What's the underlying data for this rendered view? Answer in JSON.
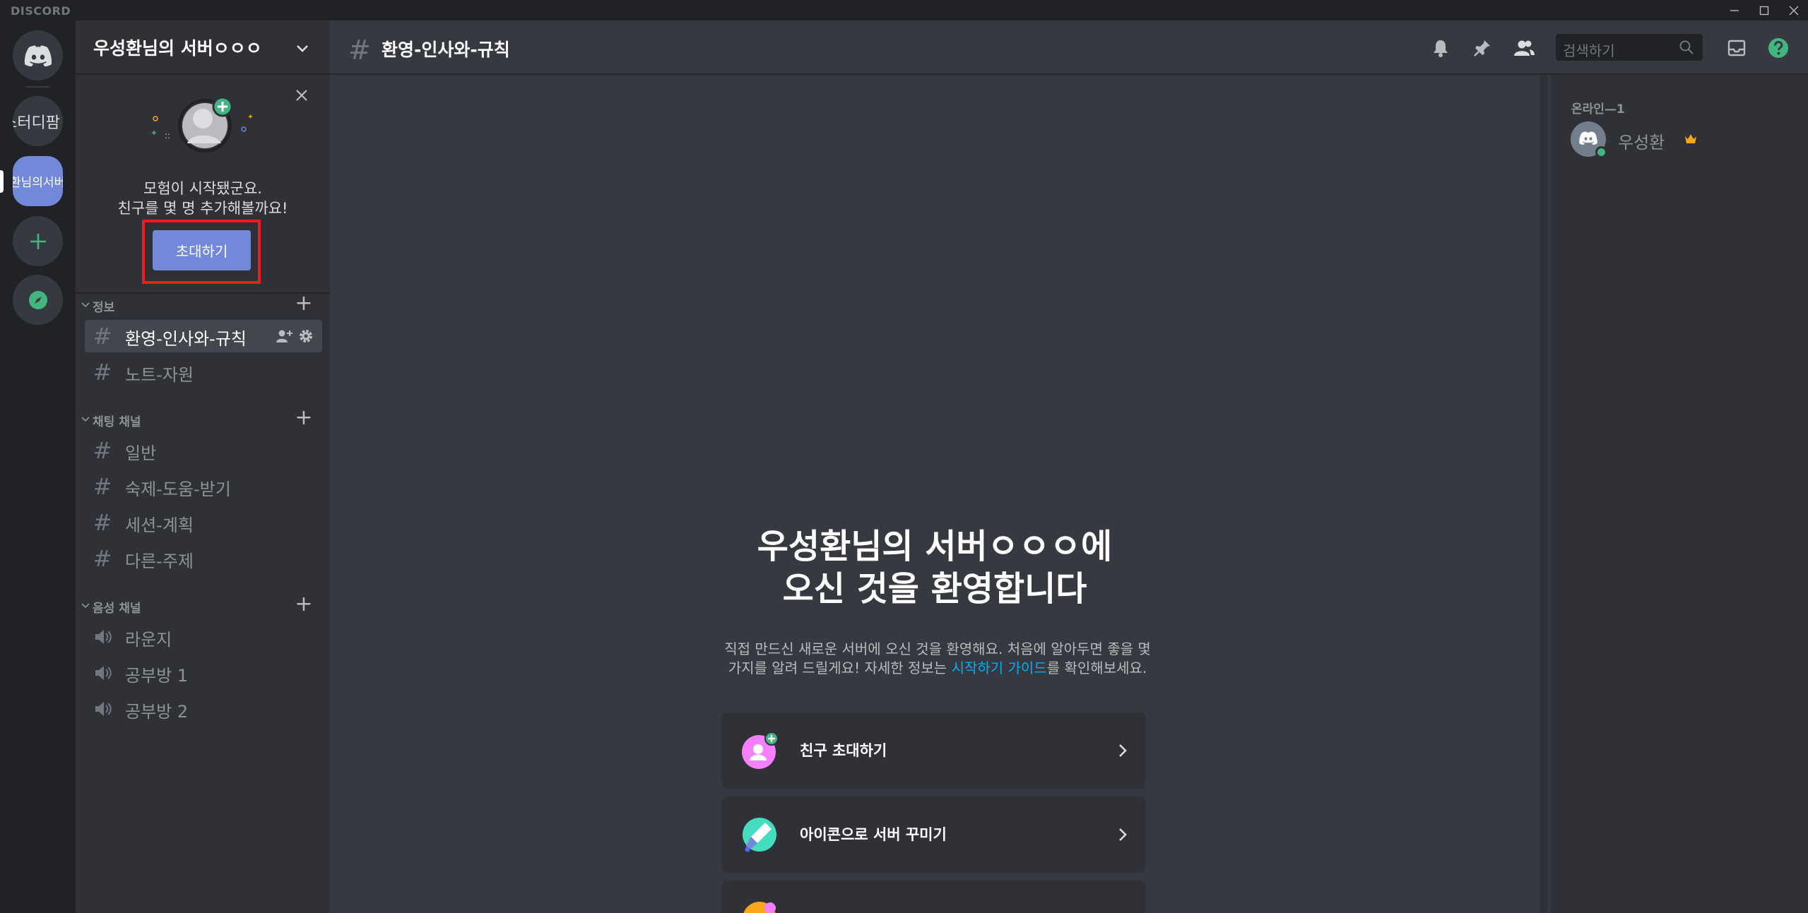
{
  "app": {
    "brand": "DISCORD"
  },
  "servers": [
    {
      "name": "home",
      "label": ""
    },
    {
      "name": "study",
      "label": "스터디팜"
    },
    {
      "name": "active",
      "label": "환님의서버ㅇ"
    }
  ],
  "guild": {
    "name": "우성환님의 서버ㅇㅇㅇ"
  },
  "invite": {
    "line1": "모험이 시작됐군요.",
    "line2": "친구를 몇 명 추가해볼까요!",
    "button": "초대하기"
  },
  "categories": [
    {
      "label": "정보"
    },
    {
      "label": "채팅 채널"
    },
    {
      "label": "음성 채널"
    }
  ],
  "channels": {
    "info": [
      "환영-인사와-규칙",
      "노트-자원"
    ],
    "text": [
      "일반",
      "숙제-도움-받기",
      "세션-계획",
      "다른-주제"
    ],
    "voice": [
      "라운지",
      "공부방 1",
      "공부방 2"
    ]
  },
  "header": {
    "channel": "환영-인사와-규칙",
    "search_placeholder": "검색하기"
  },
  "welcome": {
    "title_line1": "우성환님의 서버ㅇㅇㅇ에",
    "title_line2": "오신 것을 환영합니다",
    "desc_part1": "직접 만드신 새로운 서버에 오신 것을 환영해요. 처음에 알아두면 좋을 몇 가지를 알려 드릴게요! 자세한 정보는 ",
    "desc_link": "시작하기 가이드",
    "desc_part2": "를 확인해보세요."
  },
  "actions": [
    {
      "label": "친구 초대하기"
    },
    {
      "label": "아이콘으로 서버 꾸미기"
    }
  ],
  "members": {
    "category": "온라인—1",
    "list": [
      {
        "name": "우성환",
        "status": "online"
      }
    ]
  },
  "colors": {
    "accent": "#7289da",
    "online": "#43b581",
    "highlight": "#ed1c24",
    "link": "#00aff4"
  }
}
